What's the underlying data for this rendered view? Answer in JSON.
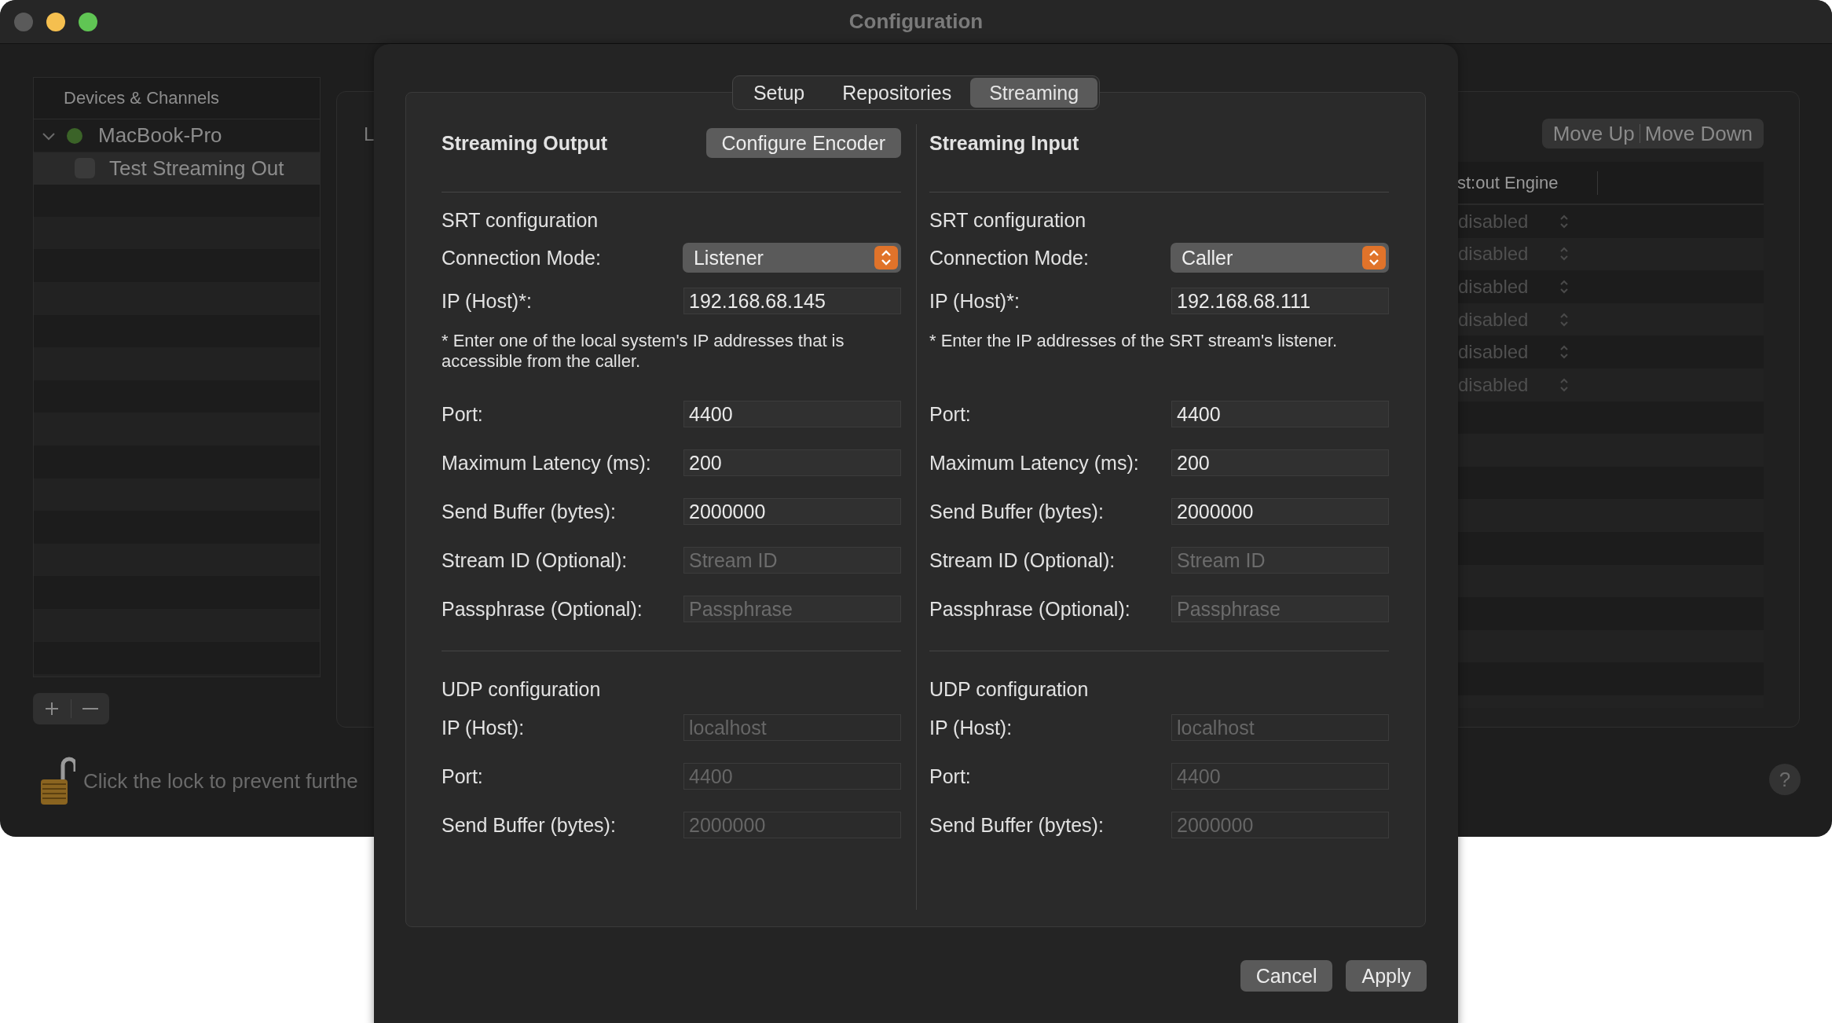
{
  "window": {
    "title": "Configuration"
  },
  "sidebar": {
    "header": "Devices & Channels",
    "items": [
      {
        "label": "MacBook-Pro",
        "expanded": true,
        "color": "#3b6328",
        "selected": false,
        "children": [
          {
            "label": "Test Streaming Out",
            "checked": false,
            "selected": true
          }
        ]
      }
    ]
  },
  "panel": {
    "label_cut": "L",
    "buttons": [
      "Move Up",
      "Move Down"
    ],
    "table": {
      "columns": [
        "st:out Engine"
      ],
      "rows": [
        {
          "value": "disabled"
        },
        {
          "value": "disabled"
        },
        {
          "value": "disabled"
        },
        {
          "value": "disabled"
        },
        {
          "value": "disabled"
        },
        {
          "value": "disabled"
        }
      ]
    }
  },
  "lock_text": "Click the lock to prevent furthe",
  "help_button": "?",
  "sheet": {
    "tabs": [
      {
        "label": "Setup",
        "selected": false
      },
      {
        "label": "Repositories",
        "selected": false
      },
      {
        "label": "Streaming",
        "selected": true
      }
    ],
    "columns": [
      {
        "title": "Streaming Output",
        "button": "Configure Encoder",
        "sections": [
          {
            "title": "SRT configuration",
            "fields": [
              {
                "label": "Connection Mode:",
                "kind": "select",
                "value": "Listener"
              },
              {
                "label": "IP (Host)*:",
                "kind": "text",
                "value": "192.168.68.145",
                "note": "* Enter one of the local system's IP addresses that is accessible from the caller."
              },
              {
                "label": "Port:",
                "kind": "text",
                "value": "4400"
              },
              {
                "label": "Maximum Latency (ms):",
                "kind": "text",
                "value": "200"
              },
              {
                "label": "Send Buffer (bytes):",
                "kind": "text",
                "value": "2000000"
              },
              {
                "label": "Stream ID (Optional):",
                "kind": "text",
                "placeholder": "Stream ID"
              },
              {
                "label": "Passphrase (Optional):",
                "kind": "text",
                "placeholder": "Passphrase"
              }
            ]
          },
          {
            "title": "UDP configuration",
            "fields": [
              {
                "label": "IP (Host):",
                "kind": "text",
                "value": "localhost",
                "disabled": true
              },
              {
                "label": "Port:",
                "kind": "text",
                "value": "4400",
                "disabled": true
              },
              {
                "label": "Send Buffer (bytes):",
                "kind": "text",
                "value": "2000000",
                "disabled": true
              }
            ]
          }
        ]
      },
      {
        "title": "Streaming Input",
        "sections": [
          {
            "title": "SRT configuration",
            "fields": [
              {
                "label": "Connection Mode:",
                "kind": "select",
                "value": "Caller"
              },
              {
                "label": "IP (Host)*:",
                "kind": "text",
                "value": "192.168.68.111",
                "note": "* Enter the IP addresses of the SRT stream's listener."
              },
              {
                "label": "Port:",
                "kind": "text",
                "value": "4400"
              },
              {
                "label": "Maximum Latency (ms):",
                "kind": "text",
                "value": "200"
              },
              {
                "label": "Send Buffer (bytes):",
                "kind": "text",
                "value": "2000000"
              },
              {
                "label": "Stream ID (Optional):",
                "kind": "text",
                "placeholder": "Stream ID"
              },
              {
                "label": "Passphrase (Optional):",
                "kind": "text",
                "placeholder": "Passphrase"
              }
            ]
          },
          {
            "title": "UDP configuration",
            "fields": [
              {
                "label": "IP (Host):",
                "kind": "text",
                "value": "localhost",
                "disabled": true
              },
              {
                "label": "Port:",
                "kind": "text",
                "value": "4400",
                "disabled": true
              },
              {
                "label": "Send Buffer (bytes):",
                "kind": "text",
                "value": "2000000",
                "disabled": true
              }
            ]
          }
        ]
      }
    ],
    "buttons": [
      "Cancel",
      "Apply"
    ]
  }
}
